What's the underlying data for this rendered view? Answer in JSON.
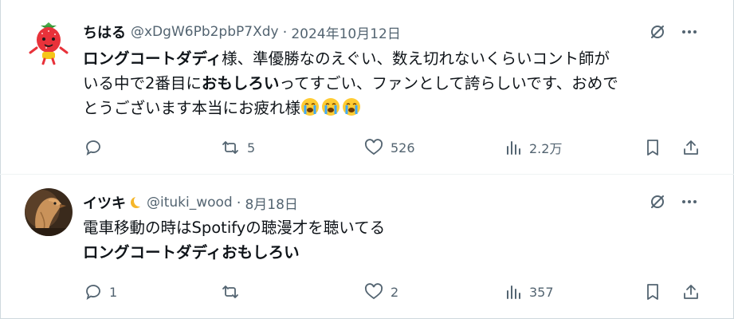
{
  "tweets": [
    {
      "name": "ちはる",
      "handle": "@xDgW6Pb2pbP7Xdy",
      "separator": "·",
      "date": "2024年10月12日",
      "text": {
        "bold1": "ロングコートダディ",
        "part1": "様、準優勝なのえぐい、数え切れないくらいコント師が",
        "part2": "いる中で2番目に",
        "bold2": "おもしろい",
        "part3": "ってすごい、ファンとして誇らしいです、おめで",
        "part4": "とうございます本当にお疲れ様"
      },
      "emoji": [
        "loudly-crying-face",
        "loudly-crying-face",
        "loudly-crying-face"
      ],
      "replies": "",
      "reposts": "5",
      "likes": "526",
      "views": "2.2万",
      "avatar_icon": "strawberry-character-icon"
    },
    {
      "name": "イツキ",
      "name_emoji": "crescent-moon-icon",
      "handle": "@ituki_wood",
      "separator": "·",
      "date": "8月18日",
      "text": {
        "line1": "電車移動の時はSpotifyの聴漫才を聴いてる",
        "line2": "ロングコートダディおもしろい"
      },
      "replies": "1",
      "reposts": "",
      "likes": "2",
      "views": "357",
      "avatar_icon": "wooden-bird-icon"
    }
  ],
  "icons": {
    "reply": "reply-icon",
    "repost": "repost-icon",
    "like": "like-icon",
    "views": "views-icon",
    "bookmark": "bookmark-icon",
    "share": "share-icon",
    "grok": "grok-icon",
    "more": "more-icon"
  },
  "colors": {
    "text": "#0f1419",
    "secondary": "#536471",
    "divider": "#eff3f4"
  }
}
